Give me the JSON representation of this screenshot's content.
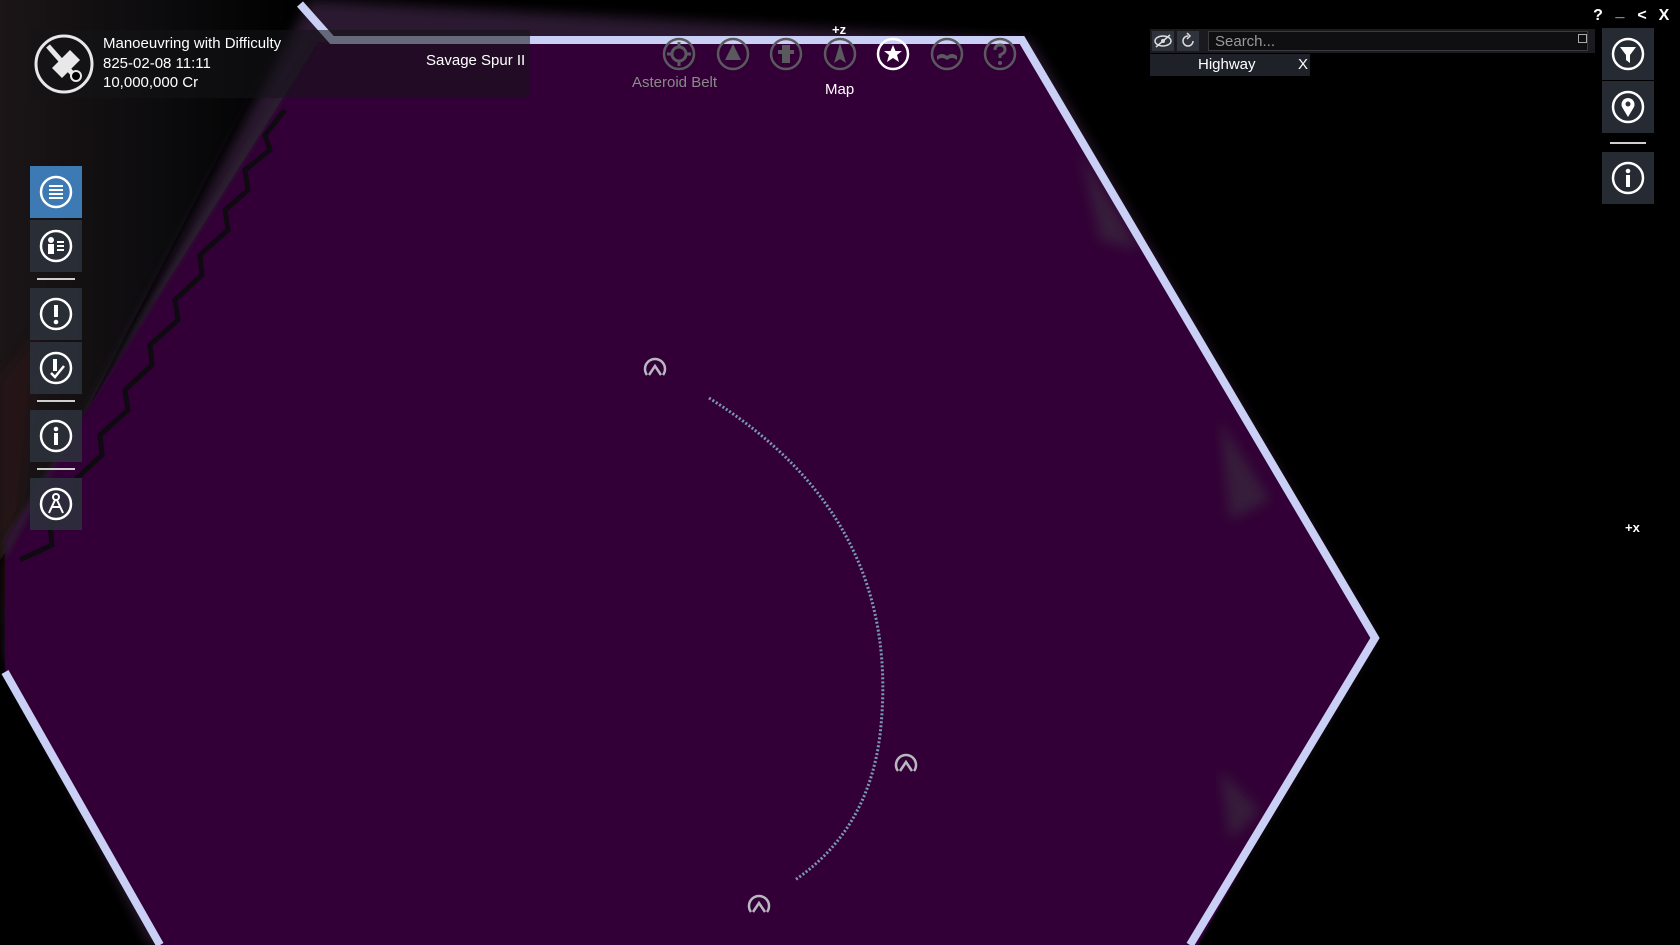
{
  "header": {
    "title": "Manoeuvring with Difficulty",
    "datetime": "825-02-08 11:11",
    "credits": "10,000,000 Cr",
    "location": "Savage Spur II"
  },
  "nav": {
    "items": [
      {
        "icon": "gear-icon"
      },
      {
        "icon": "planet-icon"
      },
      {
        "icon": "station-icon"
      },
      {
        "icon": "ship-icon"
      },
      {
        "icon": "star-map-icon",
        "active": true
      },
      {
        "icon": "book-icon"
      },
      {
        "icon": "help-icon"
      }
    ],
    "hover_label": "Asteroid Belt",
    "active_label": "Map"
  },
  "axes": {
    "z_label": "+z",
    "x_label": "+x"
  },
  "sidebar": {
    "items": [
      {
        "icon": "list-icon",
        "active": true
      },
      {
        "icon": "person-info-icon"
      },
      {
        "icon": "alert-icon"
      },
      {
        "icon": "mission-check-icon"
      },
      {
        "icon": "info-icon"
      },
      {
        "icon": "compass-icon"
      }
    ]
  },
  "search": {
    "placeholder": "Search...",
    "value": "",
    "filter_tag": "Highway",
    "filter_tag_close": "X"
  },
  "window_controls": {
    "help": "?",
    "minimize": "_",
    "back": "<",
    "close": "X"
  },
  "right_panel": {
    "items": [
      {
        "icon": "filter-icon"
      },
      {
        "icon": "location-pin-icon"
      },
      {
        "icon": "info-icon"
      }
    ]
  },
  "colors": {
    "space": "#000000",
    "sector_fill": "#320036",
    "sector_border": "#c9cff5",
    "sidebar_active": "#3d79b3",
    "button_bg": "#2d323c",
    "route_line": "#7a97b6"
  },
  "map_markers": [
    {
      "icon": "highway-node-icon"
    },
    {
      "icon": "highway-node-icon"
    },
    {
      "icon": "highway-node-icon"
    }
  ]
}
